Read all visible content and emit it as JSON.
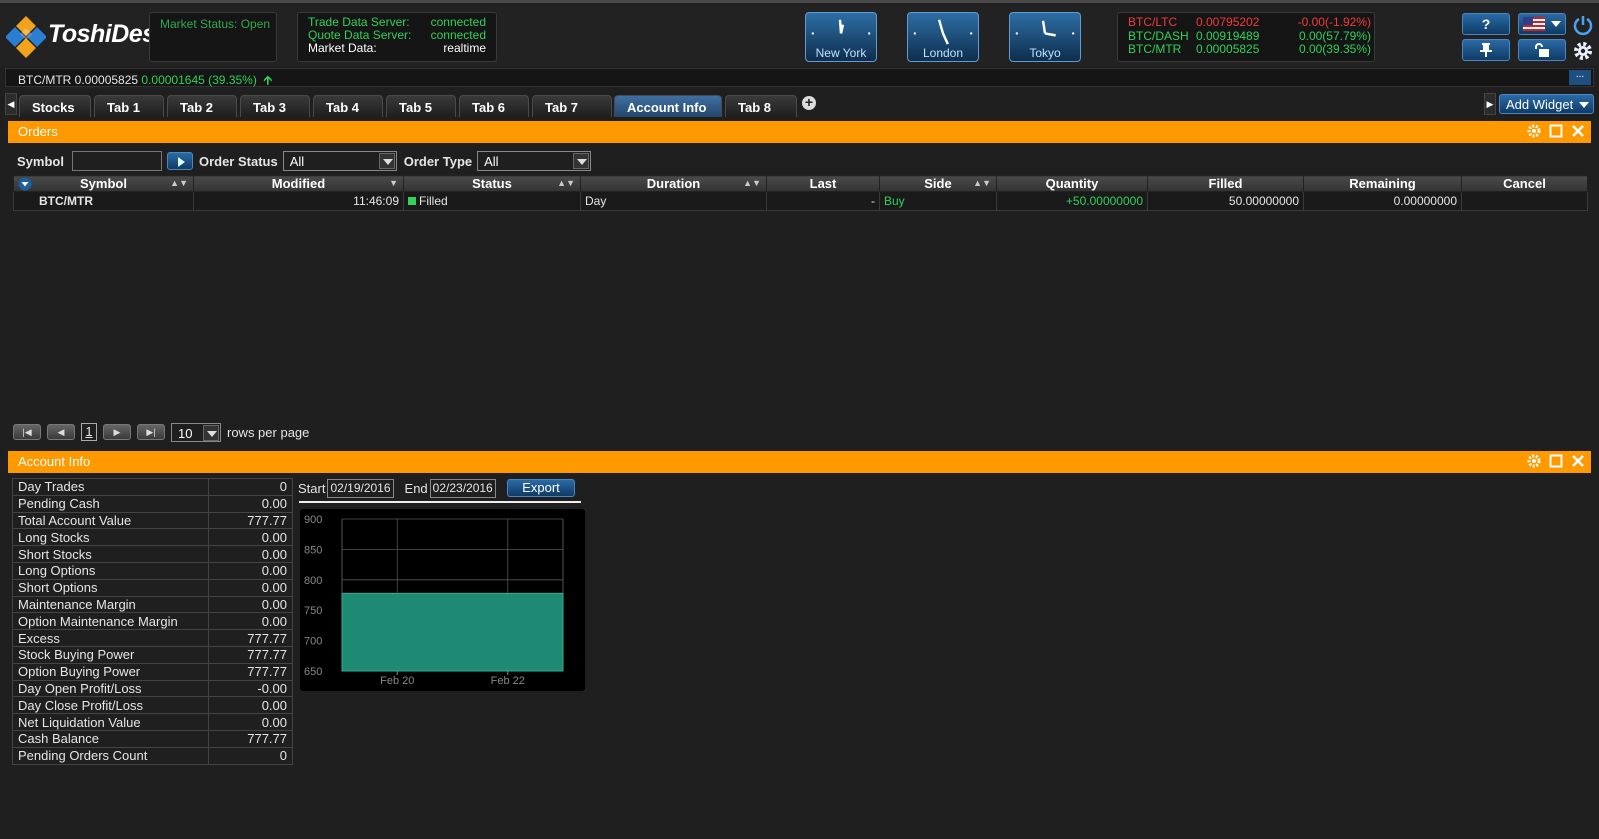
{
  "header": {
    "logo_text": "ToshiDesk",
    "market_status": "Market Status: Open",
    "servers": [
      {
        "label": "Trade Data Server:",
        "value": "connected"
      },
      {
        "label": "Quote Data Server:",
        "value": "connected"
      },
      {
        "label": "Market Data:",
        "value": "realtime"
      }
    ],
    "clocks": [
      {
        "label": "New York"
      },
      {
        "label": "London"
      },
      {
        "label": "Tokyo"
      }
    ],
    "tickers": [
      {
        "pair": "BTC/LTC",
        "price": "0.00795202",
        "change": "-0.00(-1.92%)",
        "color": "#f23a3a"
      },
      {
        "pair": "BTC/DASH",
        "price": "0.00919489",
        "change": "0.00(57.79%)",
        "color": "#2fd15a"
      },
      {
        "pair": "BTC/MTR",
        "price": "0.00005825",
        "change": "0.00(39.35%)",
        "color": "#2fd15a"
      }
    ],
    "help_label": "?",
    "accent": "#ff9900"
  },
  "strip": {
    "pair_price": "BTC/MTR 0.00005825",
    "change": "0.00001645 (39.35%)",
    "more_label": "..."
  },
  "tabs": [
    "Stocks",
    "Tab 1",
    "Tab 2",
    "Tab 3",
    "Tab 4",
    "Tab 5",
    "Tab 6",
    "Tab 7",
    "Account Info",
    "Tab 8"
  ],
  "active_tab": "Account Info",
  "add_widget_label": "Add Widget",
  "orders": {
    "title": "Orders",
    "filters": {
      "symbol_label": "Symbol",
      "symbol_value": "",
      "status_label": "Order Status",
      "status_value": "All",
      "type_label": "Order Type",
      "type_value": "All"
    },
    "columns": [
      "Symbol",
      "Modified",
      "Status",
      "Duration",
      "Last",
      "Side",
      "Quantity",
      "Filled",
      "Remaining",
      "Cancel"
    ],
    "rows": [
      {
        "symbol": "BTC/MTR",
        "modified": "11:46:09",
        "status": "Filled",
        "duration": "Day",
        "last": "-",
        "side": "Buy",
        "quantity": "+50.00000000",
        "filled": "50.00000000",
        "remaining": "0.00000000",
        "cancel": ""
      }
    ],
    "pager": {
      "page": "1",
      "rows_per_page": "10",
      "rows_label": "rows per page"
    }
  },
  "account": {
    "title": "Account Info",
    "rows": [
      {
        "label": "Day Trades",
        "value": "0"
      },
      {
        "label": "Pending Cash",
        "value": "0.00"
      },
      {
        "label": "Total Account Value",
        "value": "777.77"
      },
      {
        "label": "Long Stocks",
        "value": "0.00"
      },
      {
        "label": "Short Stocks",
        "value": "0.00"
      },
      {
        "label": "Long Options",
        "value": "0.00"
      },
      {
        "label": "Short Options",
        "value": "0.00"
      },
      {
        "label": "Maintenance Margin",
        "value": "0.00"
      },
      {
        "label": "Option Maintenance Margin",
        "value": "0.00"
      },
      {
        "label": "Excess",
        "value": "777.77"
      },
      {
        "label": "Stock Buying Power",
        "value": "777.77"
      },
      {
        "label": "Option Buying Power",
        "value": "777.77"
      },
      {
        "label": "Day Open Profit/Loss",
        "value": "-0.00"
      },
      {
        "label": "Day Close Profit/Loss",
        "value": "0.00"
      },
      {
        "label": "Net Liquidation Value",
        "value": "0.00"
      },
      {
        "label": "Cash Balance",
        "value": "777.77"
      },
      {
        "label": "Pending Orders Count",
        "value": "0"
      }
    ],
    "start_label": "Start",
    "start_date": "02/19/2016",
    "end_label": "End",
    "end_date": "02/23/2016",
    "export_label": "Export"
  },
  "chart_data": {
    "type": "area",
    "x": [
      "Feb 19",
      "Feb 20",
      "Feb 21",
      "Feb 22",
      "Feb 23"
    ],
    "x_tick_labels": [
      "Feb 20",
      "Feb 22"
    ],
    "series": [
      {
        "values": [
          777.77,
          777.77,
          777.77,
          777.77,
          777.77
        ],
        "color": "#1e8a73"
      }
    ],
    "ylim": [
      650,
      900
    ],
    "yticks": [
      900,
      850,
      800,
      750,
      700,
      650
    ],
    "grid": true
  }
}
